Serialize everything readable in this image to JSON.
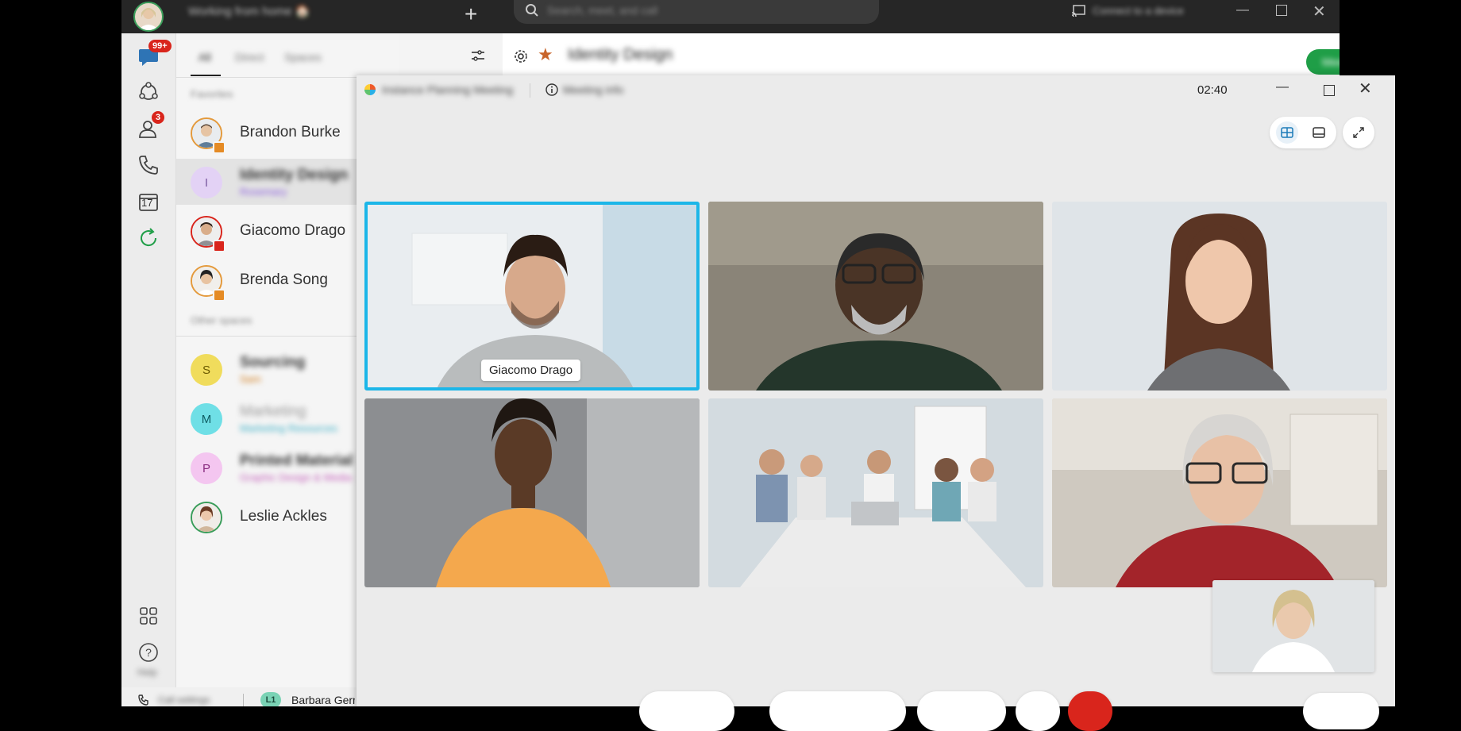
{
  "app": {
    "window_title": "Working from home 🏠",
    "search_placeholder": "Search, meet, and call",
    "connect_label": "Connect to a device"
  },
  "rail": {
    "messages_badge": "99+",
    "teams_badge": "3",
    "calendar_day": "17",
    "help_label": "Help"
  },
  "list": {
    "tabs": [
      "All",
      "Direct",
      "Spaces"
    ],
    "favorites_label": "Favorites",
    "other_label": "Other spaces",
    "favorites": [
      {
        "name": "Brandon Burke",
        "initial": ""
      },
      {
        "name": "Identity Design",
        "initial": "I",
        "sub": "Rosemary"
      },
      {
        "name": "Giacomo Drago",
        "initial": ""
      },
      {
        "name": "Brenda Song",
        "initial": ""
      }
    ],
    "others": [
      {
        "name": "Sourcing",
        "initial": "S",
        "sub": "Sam"
      },
      {
        "name": "Marketing",
        "initial": "M",
        "sub": "Marketing Resources"
      },
      {
        "name": "Printed Material",
        "initial": "P",
        "sub": "Graphic Design & Media"
      },
      {
        "name": "Leslie Ackles",
        "initial": ""
      }
    ]
  },
  "footer": {
    "call_settings": "Call settings",
    "line_badge": "L1",
    "line_user": "Barbara German"
  },
  "space": {
    "title": "Identity Design",
    "action_label": "Meet"
  },
  "meeting": {
    "title": "Instance Planning Meeting",
    "info_label": "Meeting info",
    "timer": "02:40",
    "active_speaker": "Giacomo Drago"
  },
  "colors": {
    "accent_active": "#1cb6e8",
    "badge_red": "#d9251c",
    "meet_green": "#1f9e47",
    "end_red": "#d9251c",
    "favorite_star": "#c8642a"
  }
}
